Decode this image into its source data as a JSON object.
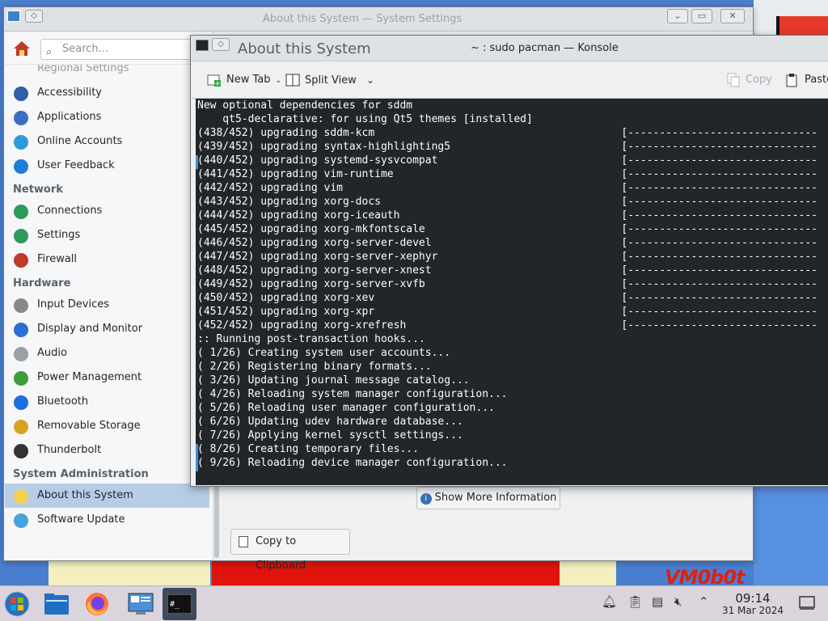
{
  "settings_window": {
    "title": "About this System — System Settings",
    "search_placeholder": "Search...",
    "sidebar": {
      "partial_item": "Regional Settings",
      "items_top": [
        {
          "label": "Accessibility",
          "icon": "accessibility-icon",
          "color": "#2f5fa8"
        },
        {
          "label": "Applications",
          "icon": "applications-icon",
          "color": "#3a6fc1"
        },
        {
          "label": "Online Accounts",
          "icon": "online-accounts-icon",
          "color": "#2d9ad7"
        },
        {
          "label": "User Feedback",
          "icon": "user-feedback-icon",
          "color": "#1c7ed6"
        }
      ],
      "network_heading": "Network",
      "network_items": [
        {
          "label": "Connections",
          "icon": "globe-icon",
          "color": "#2d9a5a"
        },
        {
          "label": "Settings",
          "icon": "network-settings-icon",
          "color": "#2d9a5a"
        },
        {
          "label": "Firewall",
          "icon": "firewall-icon",
          "color": "#c0392b"
        }
      ],
      "hardware_heading": "Hardware",
      "hardware_items": [
        {
          "label": "Input Devices",
          "icon": "input-devices-icon",
          "color": "#888888"
        },
        {
          "label": "Display and Monitor",
          "icon": "display-icon",
          "color": "#2c6ed1"
        },
        {
          "label": "Audio",
          "icon": "audio-icon",
          "color": "#9aa0a6"
        },
        {
          "label": "Power Management",
          "icon": "power-icon",
          "color": "#3b9d3b"
        },
        {
          "label": "Bluetooth",
          "icon": "bluetooth-icon",
          "color": "#1d6fe0"
        },
        {
          "label": "Removable Storage",
          "icon": "removable-storage-icon",
          "color": "#d9a321"
        },
        {
          "label": "Thunderbolt",
          "icon": "thunderbolt-icon",
          "color": "#333333"
        }
      ],
      "sysadmin_heading": "System Administration",
      "sysadmin_items": [
        {
          "label": "About this System",
          "icon": "about-icon",
          "color": "#f2d24a",
          "selected": true
        },
        {
          "label": "Software Update",
          "icon": "software-update-icon",
          "color": "#4aa3df"
        }
      ]
    },
    "content": {
      "show_more_label": "Show More Information",
      "copy_clipboard_label": "Copy to Clipboard"
    }
  },
  "konsole": {
    "title": "~ : sudo pacman — Konsole",
    "behind_title": "About this System",
    "toolbar": {
      "new_tab": "New Tab",
      "split_view": "Split View",
      "copy": "Copy",
      "paste": "Paste"
    },
    "lines": [
      "New optional dependencies for sddm",
      "    qt5-declarative: for using Qt5 themes [installed]",
      "(438/452) upgrading sddm-kcm                                       [------------------------------",
      "(439/452) upgrading syntax-highlighting5                           [------------------------------",
      "(440/452) upgrading systemd-sysvcompat                             [------------------------------",
      "(441/452) upgrading vim-runtime                                    [------------------------------",
      "(442/452) upgrading vim                                            [------------------------------",
      "(443/452) upgrading xorg-docs                                      [------------------------------",
      "(444/452) upgrading xorg-iceauth                                   [------------------------------",
      "(445/452) upgrading xorg-mkfontscale                               [------------------------------",
      "(446/452) upgrading xorg-server-devel                              [------------------------------",
      "(447/452) upgrading xorg-server-xephyr                             [------------------------------",
      "(448/452) upgrading xorg-server-xnest                              [------------------------------",
      "(449/452) upgrading xorg-server-xvfb                               [------------------------------",
      "(450/452) upgrading xorg-xev                                       [------------------------------",
      "(451/452) upgrading xorg-xpr                                       [------------------------------",
      "(452/452) upgrading xorg-xrefresh                                  [------------------------------",
      ":: Running post-transaction hooks...",
      "( 1/26) Creating system user accounts...",
      "( 2/26) Registering binary formats...",
      "( 3/26) Updating journal message catalog...",
      "( 4/26) Reloading system manager configuration...",
      "( 5/26) Reloading user manager configuration...",
      "( 6/26) Updating udev hardware database...",
      "( 7/26) Applying kernel sysctl settings...",
      "( 8/26) Creating temporary files...",
      "( 9/26) Reloading device manager configuration..."
    ]
  },
  "wallpaper": {
    "logo_text": "VM0b0t"
  },
  "taskbar": {
    "time": "09:14",
    "date": "31 Mar 2024"
  }
}
